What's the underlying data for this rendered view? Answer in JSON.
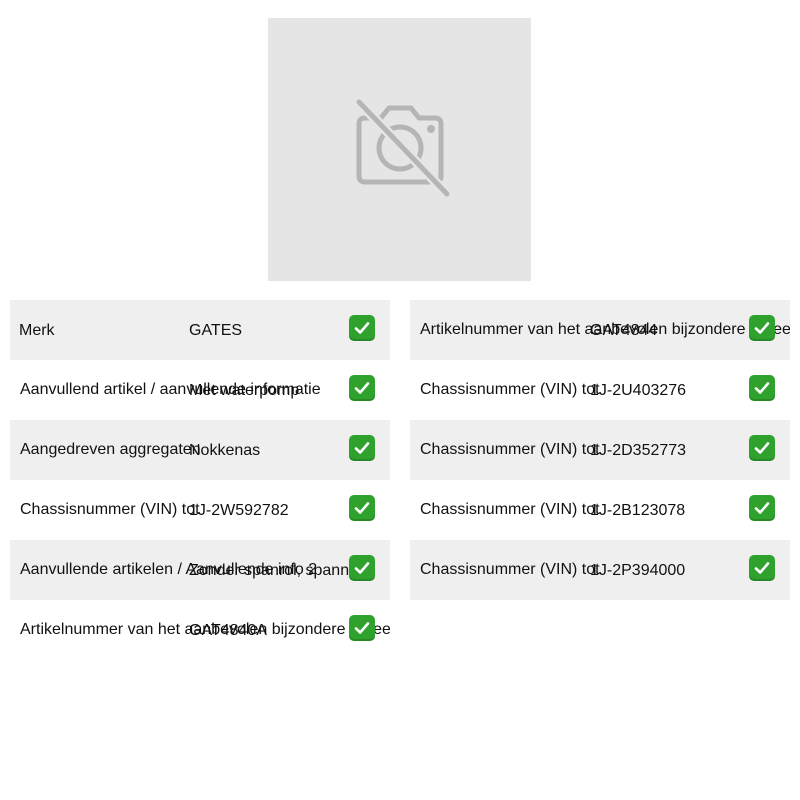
{
  "image": {
    "icon": "no-camera-icon",
    "background": "#e5e5e5"
  },
  "colors": {
    "shaded_row": "#efefef",
    "check_green": "#2ea22d"
  },
  "left_rows": [
    {
      "label": "Merk",
      "value": "GATES",
      "check": "check-mark-icon"
    },
    {
      "label": "Aanvullend artikel / aanvullende informatie",
      "value": "Met waterpomp",
      "check": "check-mark-icon"
    },
    {
      "label": "Aangedreven aggregaten",
      "value": "Nokkenas",
      "check": "check-mark-icon"
    },
    {
      "label": "Chassisnummer (VIN) tot",
      "value": "1J-2W592782",
      "check": "check-mark-icon"
    },
    {
      "label": "Aanvullende artikelen / Aanvullende info 2",
      "value": "Zonder spanrol, spanner",
      "check": "check-mark-icon"
    },
    {
      "label": "Artikelnummer van het aanbevolen bijzondere gereedschap",
      "value": "GAT4840A",
      "check": "check-mark-icon"
    }
  ],
  "right_rows": [
    {
      "label": "Artikelnummer van het aanbevolen bijzondere gereedschap",
      "value": "GAT4844",
      "check": "check-mark-icon"
    },
    {
      "label": "Chassisnummer (VIN) tot",
      "value": "1J-2U403276",
      "check": "check-mark-icon"
    },
    {
      "label": "Chassisnummer (VIN) tot",
      "value": "1J-2D352773",
      "check": "check-mark-icon"
    },
    {
      "label": "Chassisnummer (VIN) tot",
      "value": "1J-2B123078",
      "check": "check-mark-icon"
    },
    {
      "label": "Chassisnummer (VIN) tot",
      "value": "1J-2P394000",
      "check": "check-mark-icon"
    }
  ]
}
